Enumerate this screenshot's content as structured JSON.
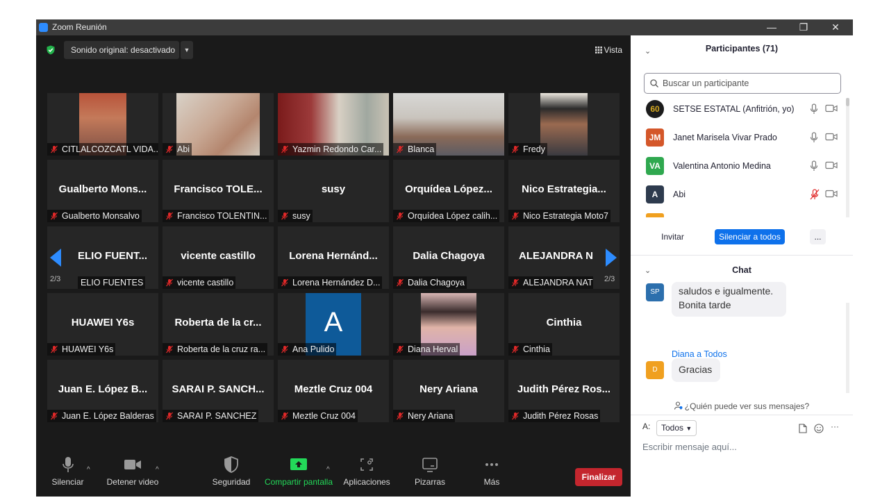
{
  "window": {
    "title": "Zoom Reunión",
    "controls": [
      "—",
      "❐",
      "✕"
    ]
  },
  "meeting": {
    "audio_button": "Sonido original: desactivado",
    "view_button": "Vista",
    "page_left": "2/3",
    "page_right": "2/3"
  },
  "tiles": [
    {
      "big": "",
      "label": "CITLALCOZCATL VIDA..."
    },
    {
      "big": "",
      "label": "Abi"
    },
    {
      "big": "",
      "label": "Yazmin Redondo Car..."
    },
    {
      "big": "",
      "label": "Blanca"
    },
    {
      "big": "",
      "label": "Fredy"
    },
    {
      "big": "Gualberto  Mons...",
      "label": "Gualberto Monsalvo"
    },
    {
      "big": "Francisco  TOLE...",
      "label": "Francisco TOLENTIN..."
    },
    {
      "big": "susy",
      "label": "susy"
    },
    {
      "big": "Orquídea  López...",
      "label": "Orquídea López calih..."
    },
    {
      "big": "Nico  Estrategia...",
      "label": "Nico Estrategia Moto7"
    },
    {
      "big": "ELIO FUENT...",
      "label": "ELIO FUENTES"
    },
    {
      "big": "vicente castillo",
      "label": "vicente castillo"
    },
    {
      "big": "Lorena  Hernánd...",
      "label": "Lorena Hernández D..."
    },
    {
      "big": "Dalia Chagoya",
      "label": "Dalia Chagoya"
    },
    {
      "big": "ALEJANDRA N",
      "label": "ALEJANDRA NAT"
    },
    {
      "big": "HUAWEI Y6s",
      "label": "HUAWEI Y6s"
    },
    {
      "big": "Roberta de la cr...",
      "label": "Roberta de la cruz ra..."
    },
    {
      "big": "A",
      "label": "Ana Pulido"
    },
    {
      "big": "",
      "label": "Diana Herval"
    },
    {
      "big": "Cinthia",
      "label": "Cinthia"
    },
    {
      "big": "Juan E. López B...",
      "label": "Juan E. López Balderas"
    },
    {
      "big": "SARAI P. SANCH...",
      "label": "SARAI P. SANCHEZ"
    },
    {
      "big": "Meztle Cruz 004",
      "label": "Meztle Cruz 004"
    },
    {
      "big": "Nery Ariana",
      "label": "Nery Ariana"
    },
    {
      "big": "Judith Pérez Ros...",
      "label": "Judith Pérez Rosas"
    }
  ],
  "toolbar": {
    "mute": "Silenciar",
    "video": "Detener video",
    "security": "Seguridad",
    "share": "Compartir pantalla",
    "apps": "Aplicaciones",
    "whiteboards": "Pizarras",
    "more": "Más",
    "end": "Finalizar"
  },
  "participants": {
    "header": "Participantes (71)",
    "search_placeholder": "Buscar un participante",
    "list": [
      {
        "initials": "60",
        "name": "SETSE ESTATAL (Anfitrión, yo)",
        "color": "#1c1c1c",
        "muted": false
      },
      {
        "initials": "JM",
        "name": "Janet Marisela Vivar Prado",
        "color": "#d4572a",
        "muted": false
      },
      {
        "initials": "VA",
        "name": "Valentina Antonio Medina",
        "color": "#2fa84f",
        "muted": false
      },
      {
        "initials": "A",
        "name": "Abi",
        "color": "#2e3b4e",
        "muted": true
      }
    ],
    "invite": "Invitar",
    "mute_all": "Silenciar a todos",
    "more": "..."
  },
  "chat": {
    "header": "Chat",
    "messages": [
      {
        "avatar": "SP",
        "avatar_color": "#2c6fad",
        "sender": "",
        "text": "saludos e igualmente. Bonita tarde"
      },
      {
        "avatar": "D",
        "avatar_color": "#f0a020",
        "sender": "Diana a Todos",
        "text": "Gracias"
      }
    ],
    "who_can_see": "¿Quién puede ver sus mensajes?",
    "to_label": "A:",
    "to_value": "Todos",
    "compose_placeholder": "Escribir mensaje aquí..."
  },
  "colors": {
    "accent": "#0e71eb",
    "end_red": "#c4262e",
    "share_green": "#23d959",
    "mute_red": "#e02828"
  }
}
